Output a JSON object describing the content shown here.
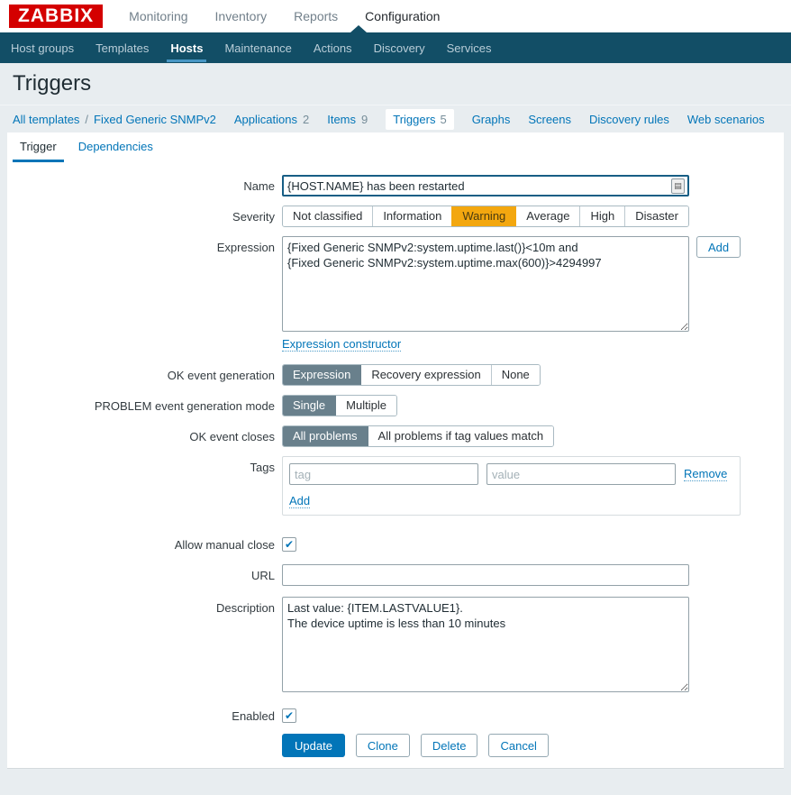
{
  "header": {
    "logo": "ZABBIX",
    "menu": [
      {
        "label": "Monitoring"
      },
      {
        "label": "Inventory"
      },
      {
        "label": "Reports"
      },
      {
        "label": "Configuration"
      }
    ]
  },
  "nav": {
    "items": [
      {
        "label": "Host groups"
      },
      {
        "label": "Templates"
      },
      {
        "label": "Hosts"
      },
      {
        "label": "Maintenance"
      },
      {
        "label": "Actions"
      },
      {
        "label": "Discovery"
      },
      {
        "label": "Services"
      }
    ]
  },
  "page": {
    "title": "Triggers"
  },
  "breadcrumb": {
    "link1": "All templates",
    "separator": "/",
    "link2": "Fixed Generic SNMPv2",
    "items": [
      {
        "label": "Applications",
        "count": "2"
      },
      {
        "label": "Items",
        "count": "9"
      },
      {
        "label": "Triggers",
        "count": "5",
        "current": true
      },
      {
        "label": "Graphs"
      },
      {
        "label": "Screens"
      },
      {
        "label": "Discovery rules"
      },
      {
        "label": "Web scenarios"
      }
    ]
  },
  "tabs": [
    {
      "label": "Trigger",
      "active": true
    },
    {
      "label": "Dependencies"
    }
  ],
  "form": {
    "name": {
      "label": "Name",
      "value": "{HOST.NAME} has been restarted"
    },
    "severity": {
      "label": "Severity",
      "options": [
        "Not classified",
        "Information",
        "Warning",
        "Average",
        "High",
        "Disaster"
      ],
      "selected": "Warning"
    },
    "expression": {
      "label": "Expression",
      "value": "{Fixed Generic SNMPv2:system.uptime.last()}<10m and\n{Fixed Generic SNMPv2:system.uptime.max(600)}>4294997",
      "add_button": "Add",
      "constructor_link": "Expression constructor"
    },
    "ok_event_generation": {
      "label": "OK event generation",
      "options": [
        "Expression",
        "Recovery expression",
        "None"
      ],
      "selected": "Expression"
    },
    "problem_mode": {
      "label": "PROBLEM event generation mode",
      "options": [
        "Single",
        "Multiple"
      ],
      "selected": "Single"
    },
    "ok_event_closes": {
      "label": "OK event closes",
      "options": [
        "All problems",
        "All problems if tag values match"
      ],
      "selected": "All problems"
    },
    "tags": {
      "label": "Tags",
      "tag_placeholder": "tag",
      "value_placeholder": "value",
      "remove_label": "Remove",
      "add_label": "Add"
    },
    "allow_manual_close": {
      "label": "Allow manual close",
      "checked": true,
      "checkmark": "✔"
    },
    "url": {
      "label": "URL",
      "value": ""
    },
    "description": {
      "label": "Description",
      "value": "Last value: {ITEM.LASTVALUE1}.\nThe device uptime is less than 10 minutes"
    },
    "enabled": {
      "label": "Enabled",
      "checked": true,
      "checkmark": "✔"
    },
    "buttons": {
      "update": "Update",
      "clone": "Clone",
      "delete": "Delete",
      "cancel": "Cancel"
    }
  },
  "colors": {
    "accent_blue": "#0275b8",
    "nav_dark": "#124e66",
    "logo_red": "#d40000",
    "warning_orange": "#f3a70f",
    "selected_gray": "#69808c",
    "page_bg": "#e8edf0"
  }
}
